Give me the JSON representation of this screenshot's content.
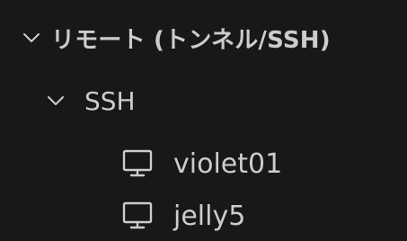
{
  "remote_explorer": {
    "section": {
      "label": "リモート (トンネル/SSH)",
      "icon": "chevron-down-icon",
      "expanded": true
    },
    "group": {
      "label": "SSH",
      "icon": "chevron-down-icon",
      "expanded": true
    },
    "hosts": [
      {
        "label": "violet01",
        "icon": "monitor-icon"
      },
      {
        "label": "jelly5",
        "icon": "monitor-icon"
      }
    ]
  },
  "colors": {
    "background": "#181818",
    "text": "#cccccc"
  }
}
